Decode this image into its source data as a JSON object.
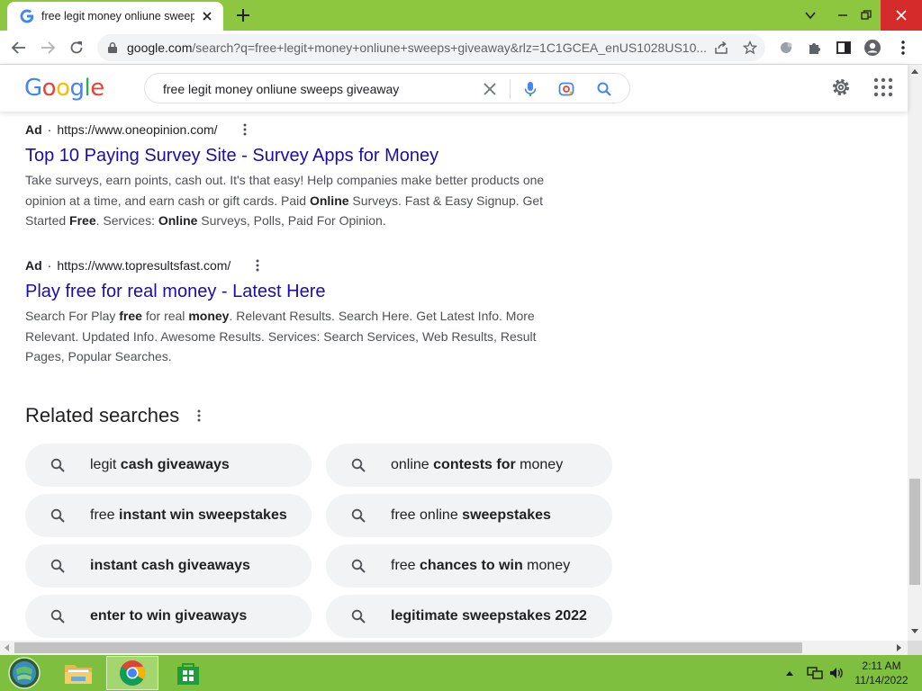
{
  "browser": {
    "tab_title": "free legit money onliune sweeps",
    "url_host": "google.com",
    "url_path": "/search?q=free+legit+money+onliune+sweeps+giveaway&rlz=1C1GCEA_enUS1028US10..."
  },
  "google": {
    "logo_letters": [
      {
        "char": "G",
        "color": "#4285f4"
      },
      {
        "char": "o",
        "color": "#ea4335"
      },
      {
        "char": "o",
        "color": "#fbbc05"
      },
      {
        "char": "g",
        "color": "#4285f4"
      },
      {
        "char": "l",
        "color": "#34a853"
      },
      {
        "char": "e",
        "color": "#ea4335"
      }
    ],
    "query": "free legit money onliune sweeps giveaway"
  },
  "ads": [
    {
      "label": "Ad",
      "url": "https://www.oneopinion.com/",
      "title": "Top 10 Paying Survey Site - Survey Apps for Money",
      "desc": [
        {
          "t": "Take surveys, earn points, cash out. It's that easy! Help companies make better products one opinion at a time, and earn cash or gift cards. Paid ",
          "b": false
        },
        {
          "t": "Online",
          "b": true
        },
        {
          "t": " Surveys. Fast & Easy Signup. Get Started ",
          "b": false
        },
        {
          "t": "Free",
          "b": true
        },
        {
          "t": ". Services: ",
          "b": false
        },
        {
          "t": "Online",
          "b": true
        },
        {
          "t": " Surveys, Polls, Paid For Opinion.",
          "b": false
        }
      ]
    },
    {
      "label": "Ad",
      "url": "https://www.topresultsfast.com/",
      "title": "Play free for real money - Latest Here",
      "desc": [
        {
          "t": "Search For Play ",
          "b": false
        },
        {
          "t": "free",
          "b": true
        },
        {
          "t": " for real ",
          "b": false
        },
        {
          "t": "money",
          "b": true
        },
        {
          "t": ". Relevant Results. Search Here. Get Latest Info. More Relevant. Updated Info. Awesome Results. Services: Search Services, Web Results, Result Pages, Popular Searches.",
          "b": false
        }
      ]
    }
  ],
  "related": {
    "title": "Related searches",
    "items": [
      [
        {
          "t": "legit ",
          "b": false
        },
        {
          "t": "cash giveaways",
          "b": true
        }
      ],
      [
        {
          "t": "online ",
          "b": false
        },
        {
          "t": "contests for",
          "b": true
        },
        {
          "t": " money",
          "b": false
        }
      ],
      [
        {
          "t": "free ",
          "b": false
        },
        {
          "t": "instant win sweepstakes",
          "b": true
        }
      ],
      [
        {
          "t": "free online ",
          "b": false
        },
        {
          "t": "sweepstakes",
          "b": true
        }
      ],
      [
        {
          "t": "instant cash giveaways",
          "b": true
        }
      ],
      [
        {
          "t": "free ",
          "b": false
        },
        {
          "t": "chances to win",
          "b": true
        },
        {
          "t": " money",
          "b": false
        }
      ],
      [
        {
          "t": "enter to win giveaways",
          "b": true
        }
      ],
      [
        {
          "t": "legitimate sweepstakes 2022",
          "b": true
        }
      ]
    ]
  },
  "taskbar": {
    "time": "2:11 AM",
    "date": "11/14/2022"
  },
  "colors": {
    "link": "#1a0dab",
    "taskbar": "#7fbf3f",
    "tabstrip": "#8dc63f"
  }
}
